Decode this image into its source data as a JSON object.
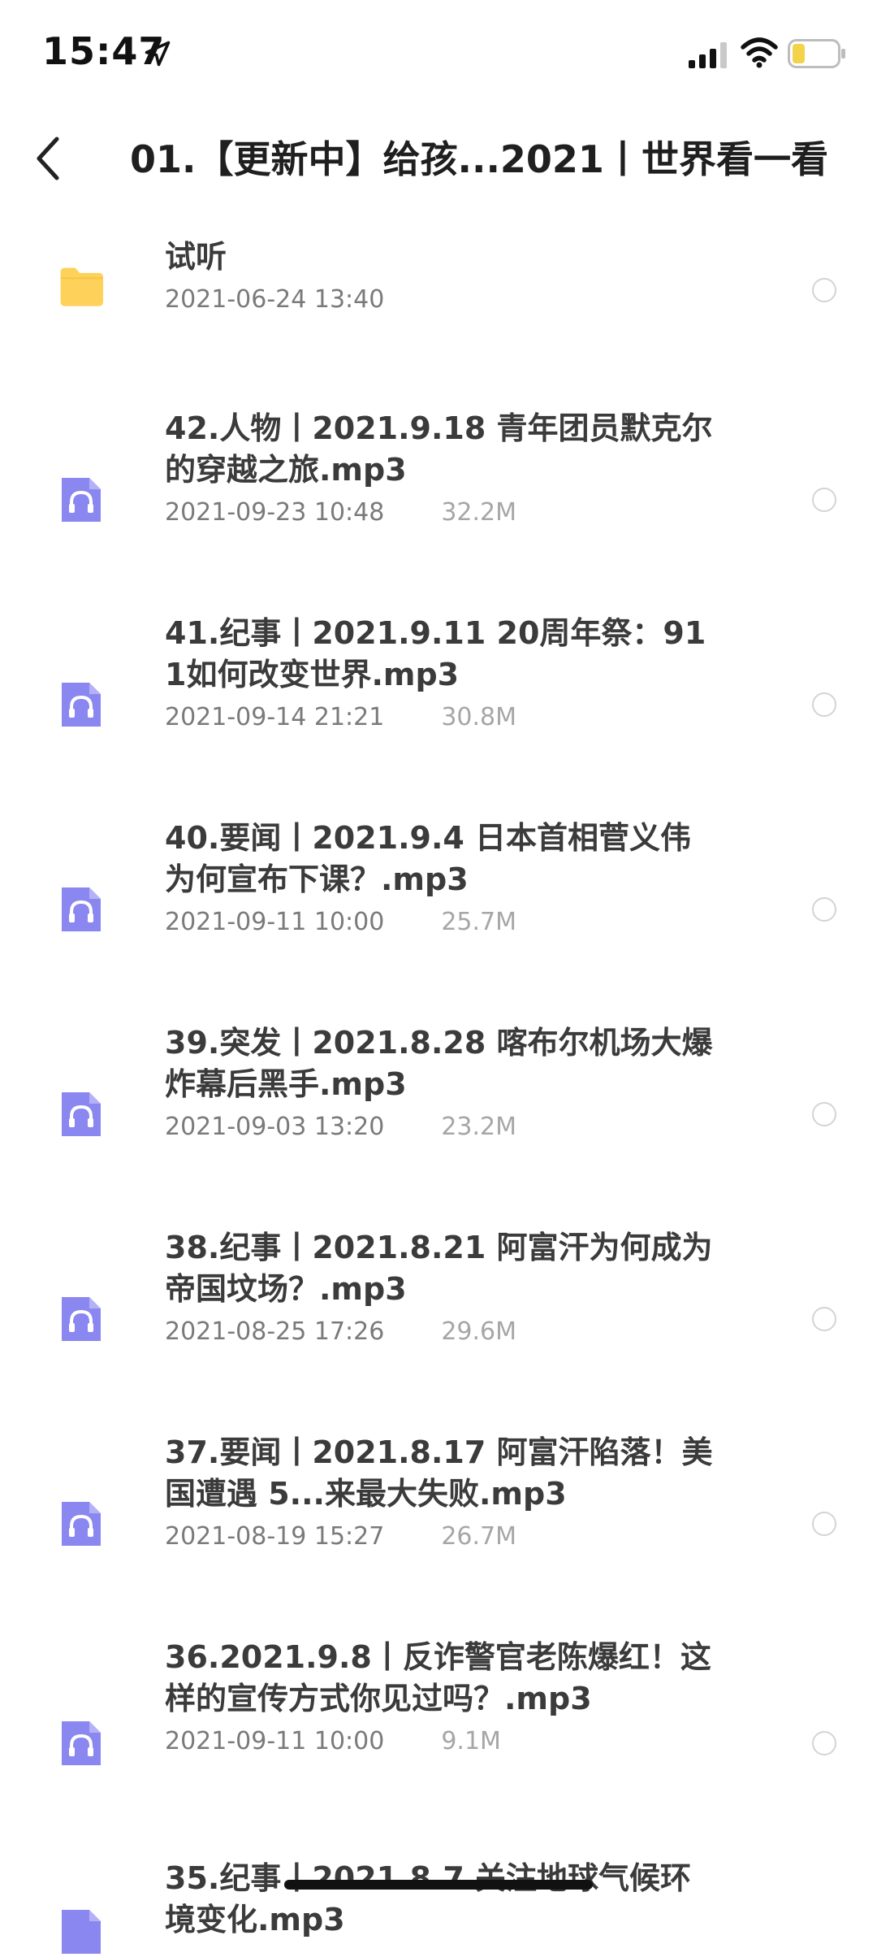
{
  "status_bar": {
    "time": "15:47",
    "location_icon": "location-arrow-icon",
    "signal_icon": "cellular-signal-icon",
    "wifi_icon": "wifi-icon",
    "battery_icon": "battery-low-icon",
    "battery_color": "#f3d34a"
  },
  "header": {
    "back_icon": "chevron-left-icon",
    "title": "01.【更新中】给孩...2021丨世界看一看"
  },
  "colors": {
    "folder": "#fdd15a",
    "audio_icon": "#8b87f0",
    "radio_border": "#d4d4d4"
  },
  "folder": {
    "icon": "folder-icon",
    "name": "试听",
    "date": "2021-06-24 13:40"
  },
  "files": [
    {
      "icon": "audio-file-icon",
      "name": "42.人物丨2021.9.18 青年团员默克尔的穿越之旅.mp3",
      "date": "2021-09-23 10:48",
      "size": "32.2M"
    },
    {
      "icon": "audio-file-icon",
      "name": "41.纪事丨2021.9.11 20周年祭：911如何改变世界.mp3",
      "date": "2021-09-14 21:21",
      "size": "30.8M"
    },
    {
      "icon": "audio-file-icon",
      "name": "40.要闻丨2021.9.4 日本首相菅义伟为何宣布下课？.mp3",
      "date": "2021-09-11 10:00",
      "size": "25.7M"
    },
    {
      "icon": "audio-file-icon",
      "name": "39.突发丨2021.8.28 喀布尔机场大爆炸幕后黑手.mp3",
      "date": "2021-09-03 13:20",
      "size": "23.2M"
    },
    {
      "icon": "audio-file-icon",
      "name": "38.纪事丨2021.8.21 阿富汗为何成为帝国坟场？.mp3",
      "date": "2021-08-25 17:26",
      "size": "29.6M"
    },
    {
      "icon": "audio-file-icon",
      "name": "37.要闻丨2021.8.17 阿富汗陷落！美国遭遇 5...来最大失败.mp3",
      "date": "2021-08-19 15:27",
      "size": "26.7M"
    },
    {
      "icon": "audio-file-icon",
      "name": "36.2021.9.8丨反诈警官老陈爆红！这样的宣传方式你见过吗？.mp3",
      "date": "2021-09-11 10:00",
      "size": "9.1M"
    },
    {
      "icon": "audio-file-icon",
      "name": "35.纪事丨2021.8.7 关注地球气候环境变化.mp3",
      "date": "",
      "size": ""
    }
  ]
}
